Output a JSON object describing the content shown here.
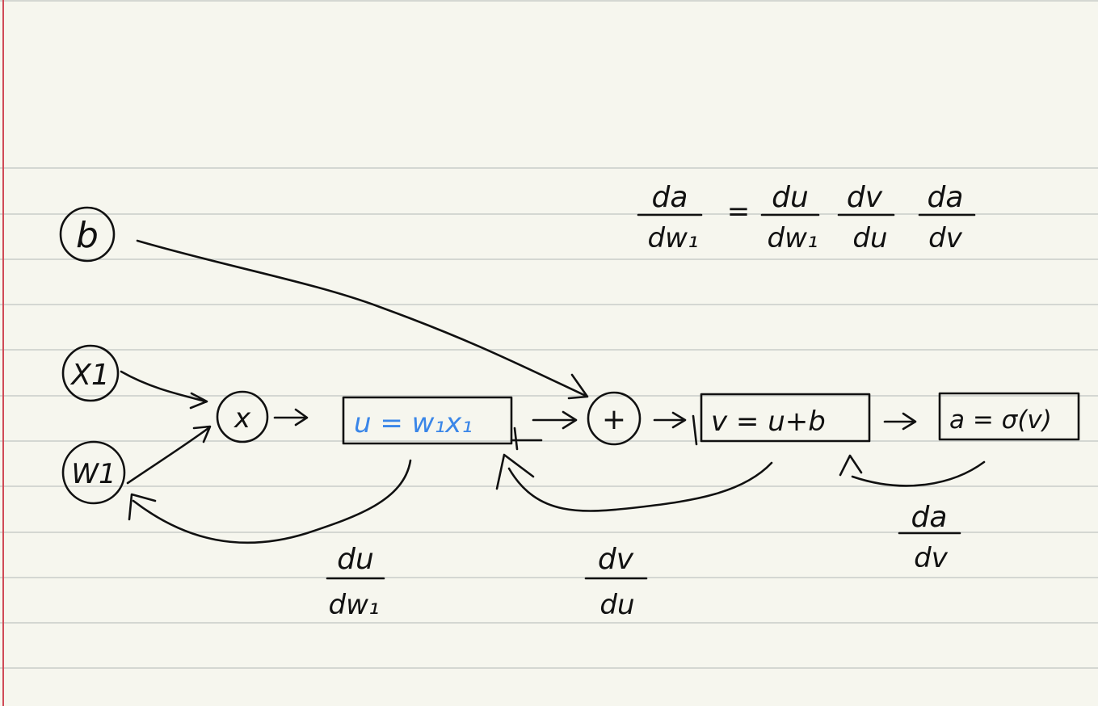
{
  "colors": {
    "paper": "#f6f6ee",
    "rule_line": "#d4d7d2",
    "margin_line": "#d04a57",
    "ink": "#111111",
    "highlight_ink": "#3a86e8"
  },
  "nodes": {
    "b": "b",
    "x1": "X1",
    "w1": "W1",
    "multiply": "x",
    "add": "+"
  },
  "boxes": {
    "u": "u = w₁x₁",
    "v": "v = u+b",
    "a": "a = σ(v)"
  },
  "gradients": {
    "chain_rule": {
      "lhs_num": "da",
      "lhs_den": "dw₁",
      "equals": "=",
      "t1_num": "du",
      "t1_den": "dw₁",
      "t2_num": "dv",
      "t2_den": "du",
      "t3_num": "da",
      "t3_den": "dv"
    },
    "du_dw1": {
      "num": "du",
      "den": "dw₁"
    },
    "dv_du": {
      "num": "dv",
      "den": "du"
    },
    "da_dv": {
      "num": "da",
      "den": "dv"
    }
  }
}
